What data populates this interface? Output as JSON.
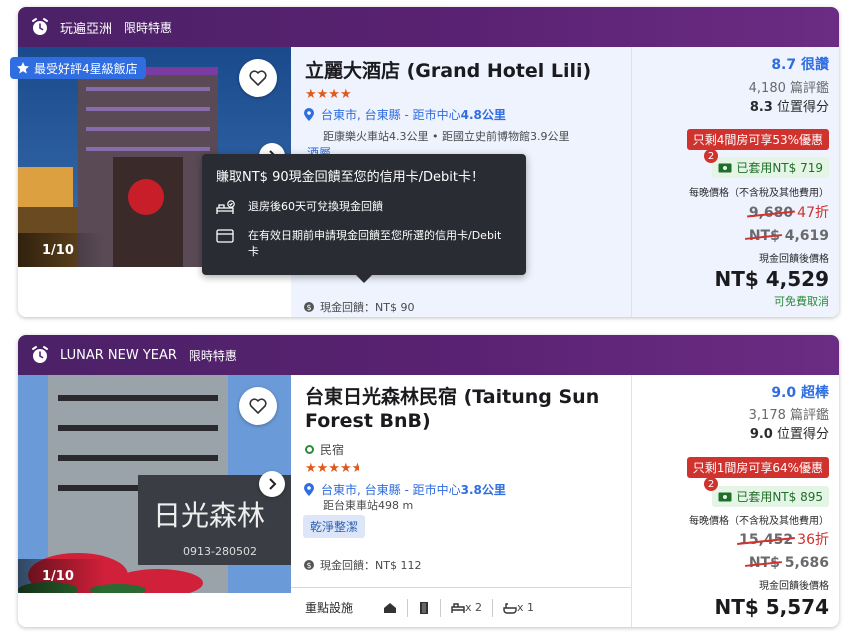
{
  "colors": {
    "deal_bar": "#5a2272",
    "accent_blue": "#2f6de0",
    "discount_red": "#d0322e",
    "orange_stars": "#e0591c",
    "green": "#2a8a3a",
    "tooltip_bg": "#2a2c33"
  },
  "hotels": [
    {
      "deal_name": "玩遍亞洲",
      "deal_tag": "限時特惠",
      "badge": "最受好評4星級飯店",
      "photo_counter": "1/10",
      "name": "立麗大酒店 (Grand Hotel Lili)",
      "stars": "★★★★",
      "location_city": "台東市, 台東縣",
      "location_distance_prefix": "距市中心",
      "location_distance": "4.8公里",
      "nearby": "距康樂火車站4.3公里 • 距國立史前博物館3.9公里",
      "peek_text": "酒屬",
      "cashback": "現金回饋：NT$ 90",
      "score": "8.7 很讚",
      "reviews": "4,180 篇評鑑",
      "location_score_value": "8.3",
      "location_score_label": "位置得分",
      "urgency": "只剩4間房可享53%優惠",
      "coupon_count": "2",
      "coupon": "已套用NT$ 719",
      "per_night": "每晚價格（不含稅及其他費用）",
      "original_price": "9,680",
      "discount": "47折",
      "mid_price_currency": "NT$",
      "mid_price": "4,619",
      "after_cashback_note": "現金回饋後價格",
      "final_price": "NT$ 4,529",
      "free_cancel": "可免費取消"
    },
    {
      "deal_name": "LUNAR NEW YEAR",
      "deal_tag": "限時特惠",
      "photo_counter": "1/10",
      "name": "台東日光森林民宿 (Taitung Sun Forest BnB)",
      "type": "民宿",
      "stars": "★★★★",
      "half_star": "★",
      "location_city": "台東市, 台東縣",
      "location_distance_prefix": "距市中心",
      "location_distance": "3.8公里",
      "nearby": "距台東車站498 m",
      "chip": "乾淨整潔",
      "cashback": "現金回饋：NT$ 112",
      "amenities_label": "重點設施",
      "amenity_bed": "x 2",
      "amenity_bath": "x 1",
      "score": "9.0 超棒",
      "reviews": "3,178 篇評鑑",
      "location_score_value": "9.0",
      "location_score_label": "位置得分",
      "urgency": "只剩1間房可享64%優惠",
      "coupon_count": "2",
      "coupon": "已套用NT$ 895",
      "per_night": "每晚價格（不含稅及其他費用）",
      "original_price": "15,452",
      "discount": "36折",
      "mid_price_currency": "NT$",
      "mid_price": "5,686",
      "after_cashback_note": "現金回饋後價格",
      "final_price": "NT$ 5,574"
    }
  ],
  "tooltip": {
    "title": "賺取NT$ 90現金回饋至您的信用卡/Debit卡！",
    "row1": "退房後60天可兌換現金回饋",
    "row2": "在有效日期前申請現金回饋至您所選的信用卡/Debit卡"
  }
}
